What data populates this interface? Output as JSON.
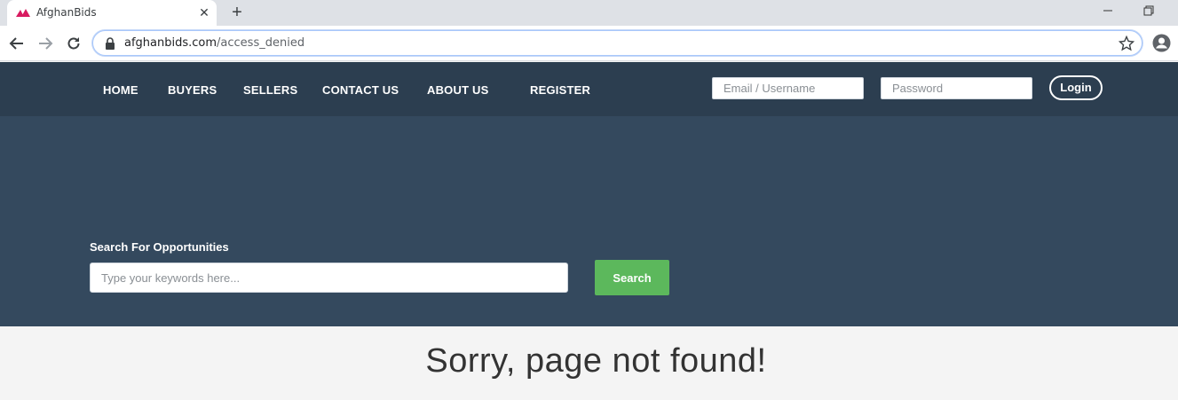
{
  "browser": {
    "tab_title": "AfghanBids",
    "new_tab_label": "+",
    "close_tab_label": "✕",
    "url_domain": "afghanbids.com",
    "url_path": "/access_denied",
    "accent_color": "#d81b60"
  },
  "nav": {
    "links": [
      "HOME",
      "BUYERS",
      "SELLERS",
      "CONTACT US",
      "ABOUT US",
      "REGISTER"
    ],
    "email_placeholder": "Email / Username",
    "password_placeholder": "Password",
    "login_label": "Login",
    "bg_color": "#2c3e50"
  },
  "hero": {
    "search_label": "Search For Opportunities",
    "search_placeholder": "Type your keywords here...",
    "search_button": "Search",
    "bg_color": "#34495e",
    "button_color": "#5cb85c"
  },
  "content": {
    "message": "Sorry, page not found!"
  }
}
